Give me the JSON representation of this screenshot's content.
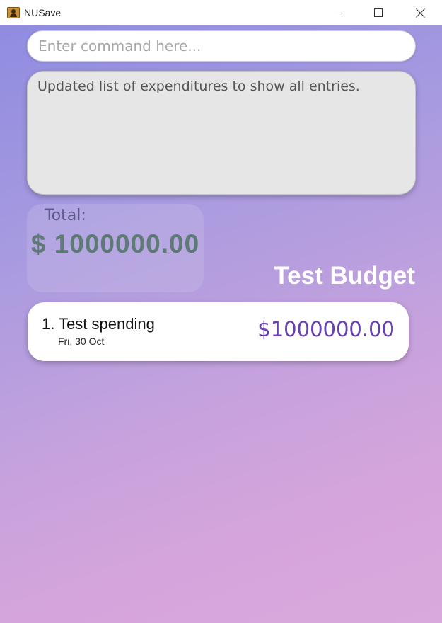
{
  "window": {
    "title": "NUSave"
  },
  "command": {
    "placeholder": "Enter command here...",
    "value": ""
  },
  "result": {
    "message": "Updated list of expenditures to show all entries."
  },
  "total": {
    "label": "Total:",
    "amount": "$ 1000000.00"
  },
  "budget": {
    "name": "Test Budget"
  },
  "expenditures": [
    {
      "name": "1. Test spending",
      "date": "Fri, 30 Oct",
      "amount": "$1000000.00"
    }
  ],
  "colors": {
    "accent_amount": "#6a3fb4",
    "total_amount": "#5e7a74",
    "gradient_start": "#8f8ce0",
    "gradient_end": "#d9a9dc"
  },
  "icons": {
    "app": "app-icon",
    "minimize": "minimize-icon",
    "maximize": "maximize-icon",
    "close": "close-icon"
  }
}
